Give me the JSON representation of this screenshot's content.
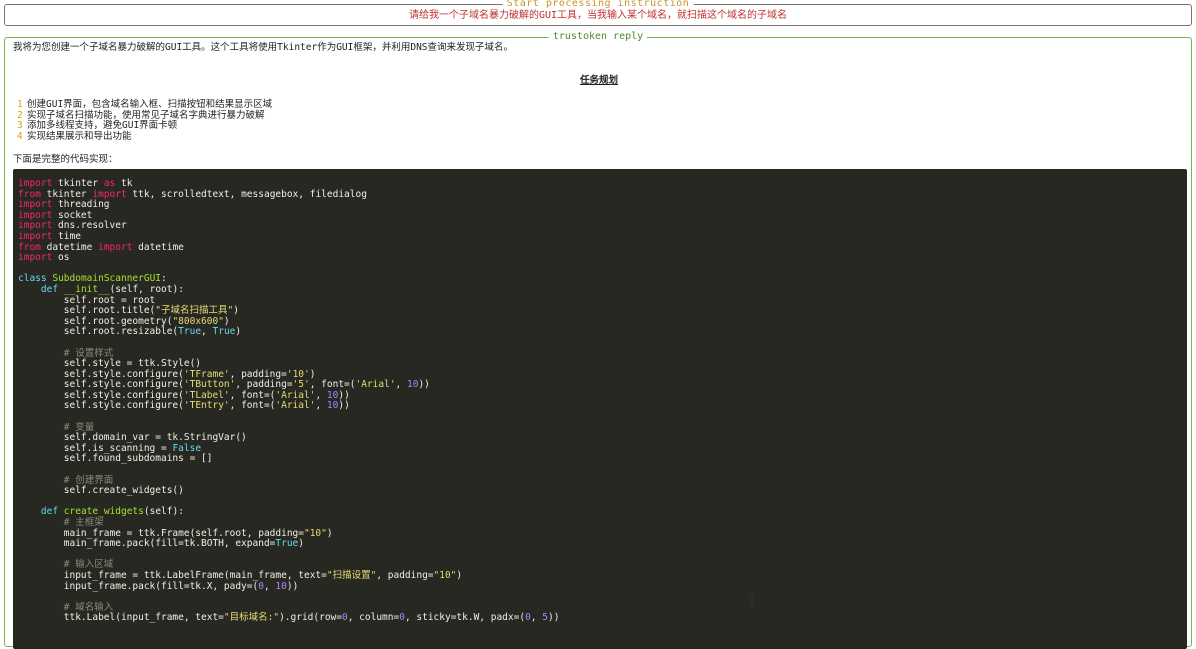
{
  "instruction_panel": {
    "title": "Start processing instruction",
    "text": "请给我一个子域名暴力破解的GUI工具，当我输入某个域名，就扫描这个域名的子域名"
  },
  "reply_panel": {
    "title": "trustoken reply",
    "intro": "我将为您创建一个子域名暴力破解的GUI工具。这个工具将使用Tkinter作为GUI框架，并利用DNS查询来发现子域名。",
    "plan_title": "任务规划",
    "plan_items": [
      {
        "num": "1",
        "text": "创建GUI界面，包含域名输入框、扫描按钮和结果显示区域"
      },
      {
        "num": "2",
        "text": "实现子域名扫描功能，使用常见子域名字典进行暴力破解"
      },
      {
        "num": "3",
        "text": "添加多线程支持，避免GUI界面卡顿"
      },
      {
        "num": "4",
        "text": "实现结果展示和导出功能"
      }
    ],
    "code_intro": "下面是完整的代码实现：",
    "code_lines": [
      "import tkinter as tk",
      "from tkinter import ttk, scrolledtext, messagebox, filedialog",
      "import threading",
      "import socket",
      "import dns.resolver",
      "import time",
      "from datetime import datetime",
      "import os",
      "",
      "class SubdomainScannerGUI:",
      "    def __init__(self, root):",
      "        self.root = root",
      "        self.root.title(\"子域名扫描工具\")",
      "        self.root.geometry(\"800x600\")",
      "        self.root.resizable(True, True)",
      "",
      "        # 设置样式",
      "        self.style = ttk.Style()",
      "        self.style.configure('TFrame', padding='10')",
      "        self.style.configure('TButton', padding='5', font=('Arial', 10))",
      "        self.style.configure('TLabel', font=('Arial', 10))",
      "        self.style.configure('TEntry', font=('Arial', 10))",
      "",
      "        # 变量",
      "        self.domain_var = tk.StringVar()",
      "        self.is_scanning = False",
      "        self.found_subdomains = []",
      "",
      "        # 创建界面",
      "        self.create_widgets()",
      "",
      "    def create_widgets(self):",
      "        # 主框架",
      "        main_frame = ttk.Frame(self.root, padding=\"10\")",
      "        main_frame.pack(fill=tk.BOTH, expand=True)",
      "",
      "        # 输入区域",
      "        input_frame = ttk.LabelFrame(main_frame, text=\"扫描设置\", padding=\"10\")",
      "        input_frame.pack(fill=tk.X, pady=(0, 10))",
      "",
      "        # 域名输入",
      "        ttk.Label(input_frame, text=\"目标域名:\").grid(row=0, column=0, sticky=tk.W, padx=(0, 5))"
    ]
  }
}
